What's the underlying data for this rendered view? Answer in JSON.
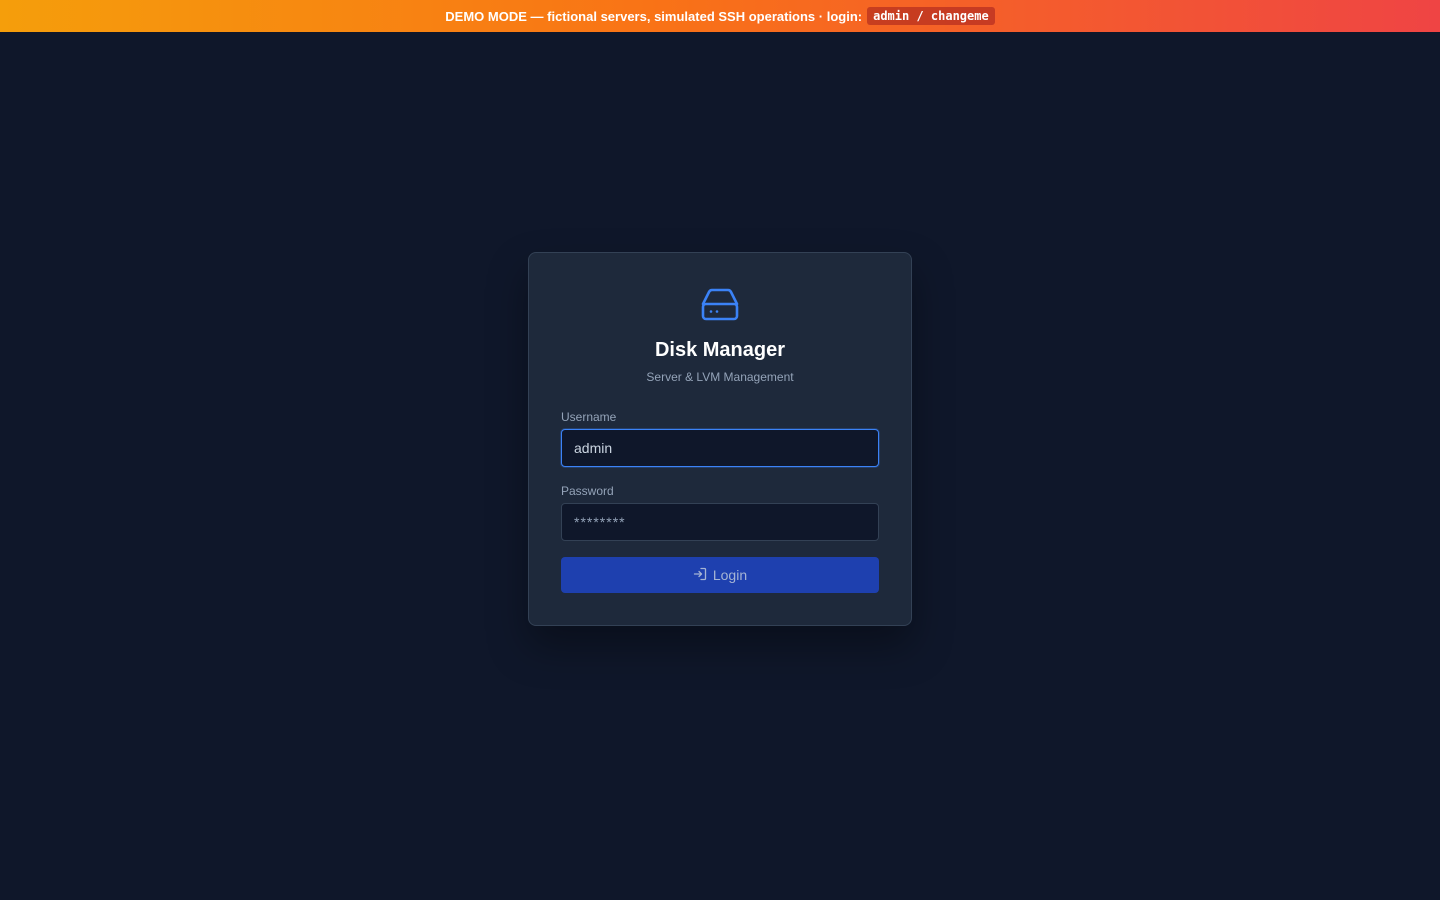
{
  "banner": {
    "text": "DEMO MODE — fictional servers, simulated SSH operations · login:",
    "credentials": "admin / changeme"
  },
  "app": {
    "icon": "hard-drive-icon",
    "title": "Disk Manager",
    "subtitle": "Server & LVM Management"
  },
  "form": {
    "username_label": "Username",
    "username_value": "admin",
    "password_label": "Password",
    "password_value": "********",
    "login_label": "Login",
    "login_icon": "login-icon"
  },
  "colors": {
    "background": "#0f172a",
    "card": "#1e293b",
    "accent": "#3b82f6",
    "button": "#1e40af",
    "banner_start": "#f59e0b",
    "banner_end": "#ef4444"
  }
}
